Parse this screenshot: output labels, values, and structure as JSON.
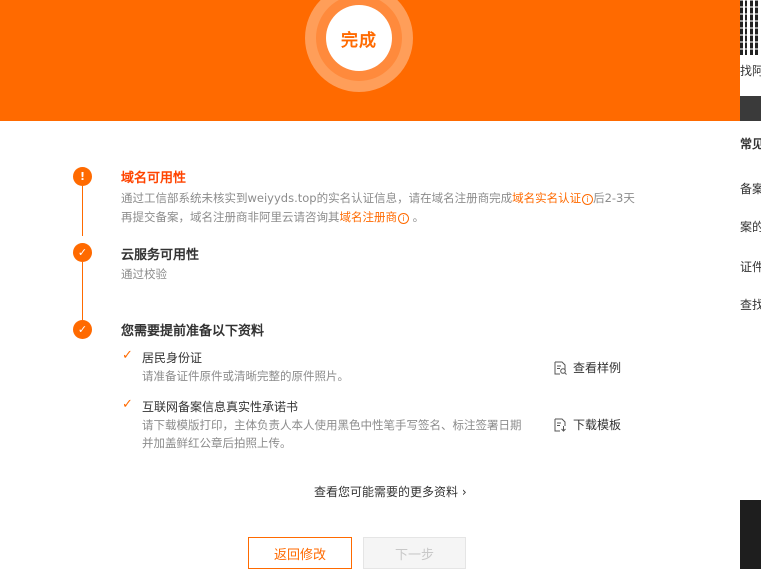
{
  "banner": {
    "status_label": "完成"
  },
  "steps": [
    {
      "icon": "info-icon",
      "title": "域名可用性",
      "desc_line1_pre": "通过工信部系统未核实到weiyyds.top的实名认证信息，请在域名注册商完成",
      "desc_line1_link": "域名实名认证",
      "desc_line1_post": "后2-3天",
      "desc_line2_pre": "再提交备案，域名注册商非阿里云请咨询其",
      "desc_line2_link": "域名注册商",
      "desc_line2_post": " 。",
      "info_mark": "i"
    },
    {
      "icon": "check-icon",
      "title": "云服务可用性",
      "desc": "通过校验"
    },
    {
      "icon": "check-icon",
      "title": "您需要提前准备以下资料"
    }
  ],
  "requirements": [
    {
      "check": "✓",
      "title": "居民身份证",
      "desc_lines": [
        "请准备证件原件或清晰完整的原件照片。"
      ],
      "action": "查看样例",
      "action_icon": "document-search-icon"
    },
    {
      "check": "✓",
      "title": "互联网备案信息真实性承诺书",
      "desc_lines": [
        "请下载模版打印，主体负责人本人使用黑色中性笔手写签名、标注签署日期",
        "并加盖鲜红公章后拍照上传。"
      ],
      "action": "下载模板",
      "action_icon": "document-download-icon"
    }
  ],
  "more_link": "查看您可能需要的更多资料 ›",
  "buttons": {
    "back": "返回修改",
    "next": "下一步"
  },
  "background": {
    "items": [
      "找阿",
      "常见",
      "备案",
      "案的",
      "证件",
      "查找"
    ]
  },
  "colors": {
    "accent": "#ff6a00",
    "warn": "#ff4400"
  }
}
